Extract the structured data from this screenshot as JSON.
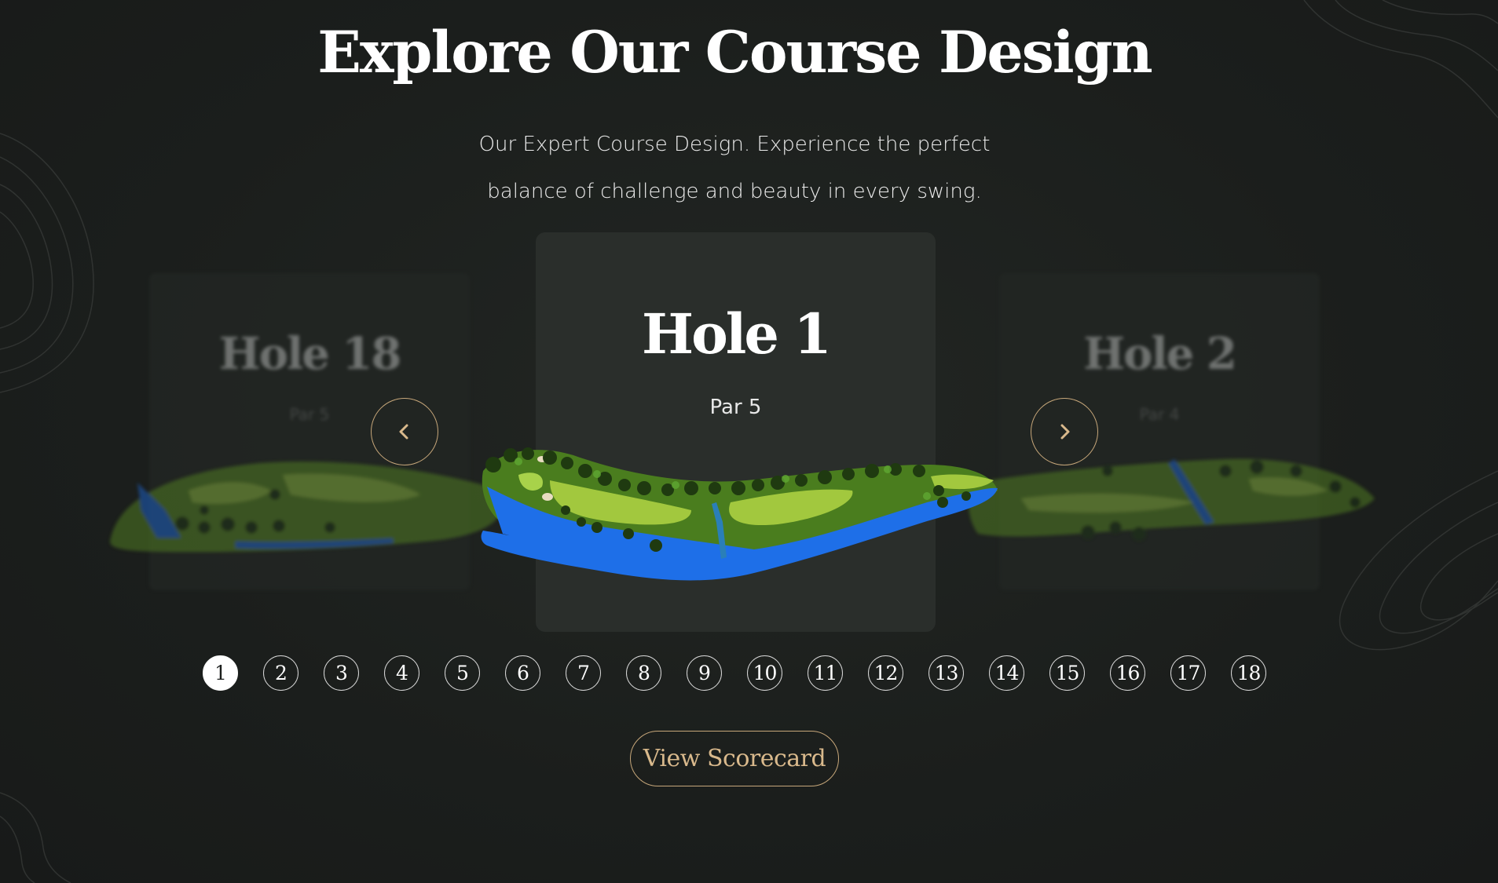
{
  "section": {
    "title": "Explore Our Course Design",
    "subtitle": "Our Expert Course Design. Experience the perfect balance of challenge and beauty in every swing."
  },
  "carousel": {
    "prev_hole": {
      "title": "Hole 18",
      "par": "Par 5"
    },
    "current_hole": {
      "title": "Hole 1",
      "par": "Par 5"
    },
    "next_hole": {
      "title": "Hole 2",
      "par": "Par 4"
    },
    "prev_icon": "chevron-left-icon",
    "next_icon": "chevron-right-icon"
  },
  "pagination": {
    "active": "1",
    "pages": [
      "1",
      "2",
      "3",
      "4",
      "5",
      "6",
      "7",
      "8",
      "9",
      "10",
      "11",
      "12",
      "13",
      "14",
      "15",
      "16",
      "17",
      "18"
    ]
  },
  "cta": {
    "label": "View Scorecard"
  },
  "colors": {
    "background": "#1c1f1d",
    "card": "#2a2e2b",
    "accent_gold": "#c7a77a",
    "fairway": "#5e8f2a",
    "water": "#1f6fe0"
  }
}
